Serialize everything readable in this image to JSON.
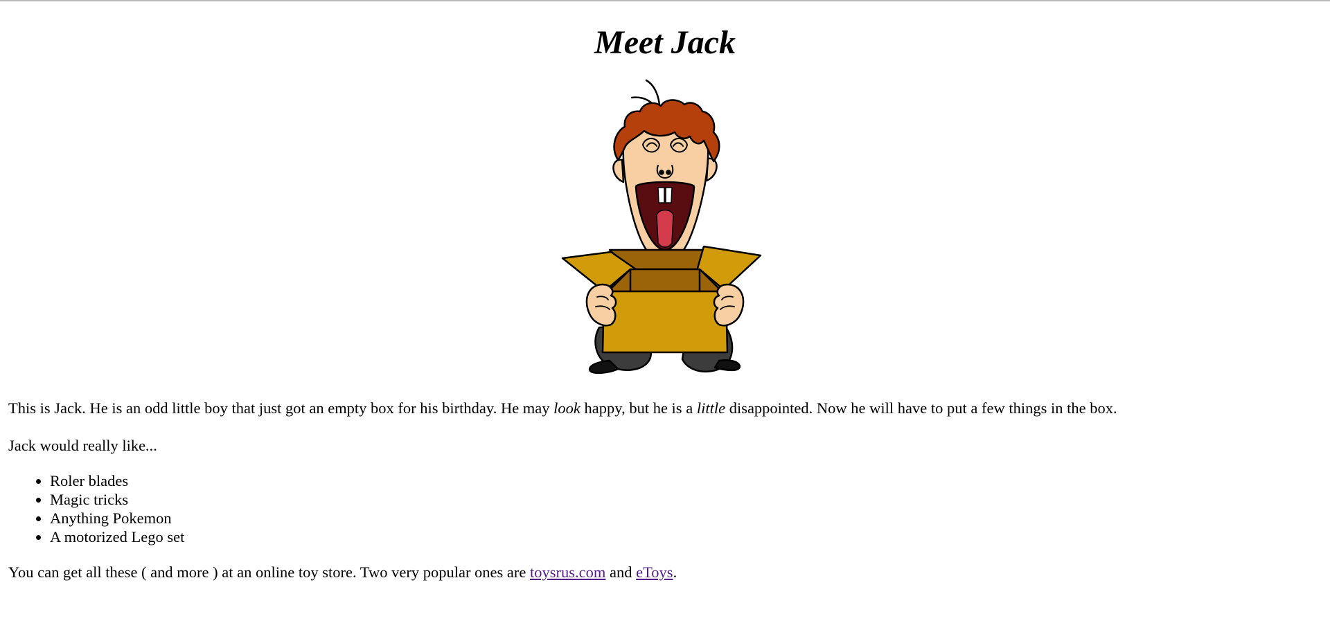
{
  "page": {
    "title": "Meet Jack"
  },
  "illustration": {
    "icon": "cartoon-boy-with-box",
    "colors": {
      "hair": "#b5400c",
      "skin": "#f7cfa3",
      "shirt": "#0a2fe0",
      "box": "#d19b0a",
      "box_dark": "#9b6408",
      "shoes": "#3c3c3c",
      "tongue": "#d43b4b"
    }
  },
  "intro": {
    "part1": "This is Jack. He is an odd little boy that just got an empty box for his birthday. He may ",
    "em1": "look",
    "part2": " happy, but he is a ",
    "em2": "little",
    "part3": " disappointed. Now he will have to put a few things in the box."
  },
  "wishes": {
    "heading": "Jack would really like...",
    "items": [
      "Roler blades",
      "Magic tricks",
      "Anything Pokemon",
      "A motorized Lego set"
    ]
  },
  "stores": {
    "part1": "You can get all these ( and more ) at an online toy store. Two very popular ones are ",
    "link1": "toysrus.com",
    "part2": " and ",
    "link2": "eToys",
    "part3": ".",
    "link_color": "#551a8b"
  }
}
